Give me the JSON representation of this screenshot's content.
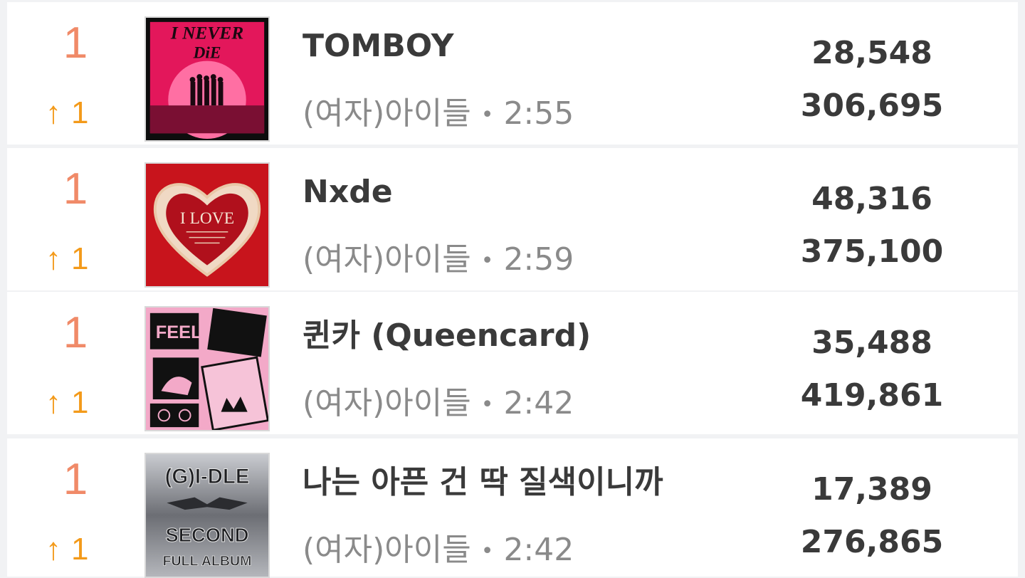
{
  "songs": [
    {
      "rank": "1",
      "change_arrow": "↑",
      "change_value": "1",
      "title": "TOMBOY",
      "artist": "(여자)아이들",
      "separator": "•",
      "duration": "2:55",
      "daily_count": "28,548",
      "total_count": "306,695",
      "cover": {
        "art": "i-never-die-cover",
        "text_top": "I NEVER",
        "text_bottom": "DiE",
        "bg": "#e3175b"
      }
    },
    {
      "rank": "1",
      "change_arrow": "↑",
      "change_value": "1",
      "title": "Nxde",
      "artist": "(여자)아이들",
      "separator": "•",
      "duration": "2:59",
      "daily_count": "48,316",
      "total_count": "375,100",
      "cover": {
        "art": "i-love-cover",
        "text_top": "I LOVE",
        "bg": "#c8141c"
      }
    },
    {
      "rank": "1",
      "change_arrow": "↑",
      "change_value": "1",
      "title": "퀸카 (Queencard)",
      "artist": "(여자)아이들",
      "separator": "•",
      "duration": "2:42",
      "daily_count": "35,488",
      "total_count": "419,861",
      "cover": {
        "art": "i-feel-cover",
        "text_top": "i FEEL",
        "bg": "#f3a9c8"
      }
    },
    {
      "rank": "1",
      "change_arrow": "↑",
      "change_value": "1",
      "title": "나는 아픈 건 딱 질색이니까",
      "artist": "(여자)아이들",
      "separator": "•",
      "duration": "2:42",
      "daily_count": "17,389",
      "total_count": "276,865",
      "cover": {
        "art": "second-full-album-cover",
        "text_top": "(G)I-DLE",
        "text_mid": "SECOND",
        "text_bottom": "FULL ALBUM",
        "bg": "#8e9096"
      }
    }
  ],
  "colors": {
    "rank": "#f08a68",
    "rank_up": "#f39a1a",
    "title": "#3a3a3a",
    "meta": "#8a8a8a"
  }
}
